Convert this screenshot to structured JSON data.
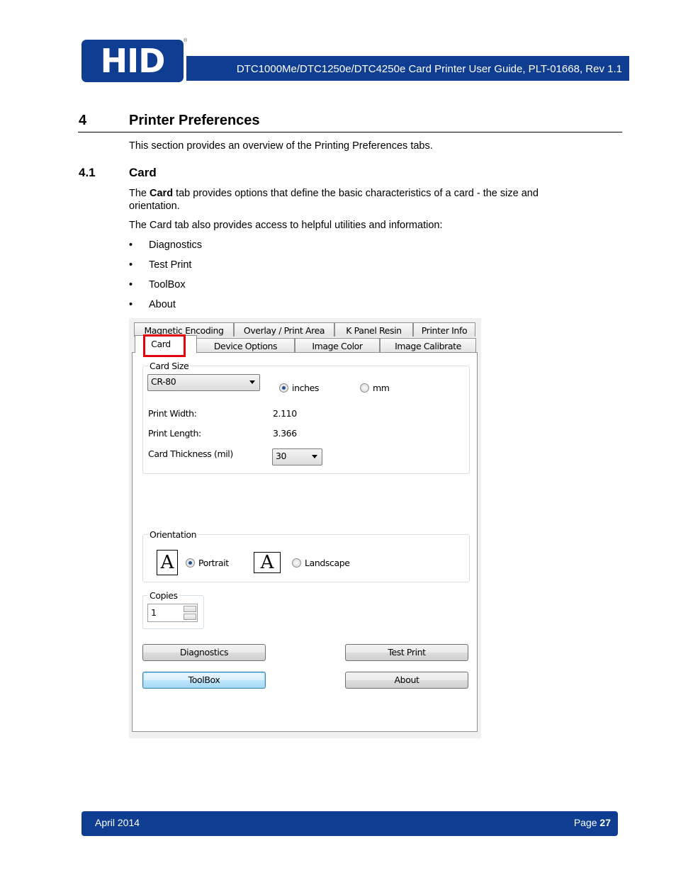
{
  "header": {
    "logo_text": "HID",
    "logo_mark": "®",
    "title": "DTC1000Me/DTC1250e/DTC4250e Card Printer User Guide, PLT-01668, Rev 1.1"
  },
  "section": {
    "number": "4",
    "title": "Printer Preferences",
    "intro": "This section provides an overview of the Printing Preferences tabs."
  },
  "subsection": {
    "number": "4.1",
    "title": "Card",
    "para1_pre": "The ",
    "para1_bold": "Card",
    "para1_post": " tab provides options that define the basic characteristics of a card - the size and orientation.",
    "para2": "The Card tab also provides access to helpful utilities and information:",
    "bullets": [
      "Diagnostics",
      "Test Print",
      "ToolBox",
      "About"
    ]
  },
  "dialog": {
    "tabs_back": [
      "Magnetic Encoding",
      "Overlay / Print Area",
      "K Panel Resin",
      "Printer Info"
    ],
    "tabs_front": [
      "Card",
      "Device Options",
      "Image Color",
      "Image Calibrate"
    ],
    "active_tab": "Card",
    "card_size": {
      "group_label": "Card Size",
      "selected": "CR-80",
      "unit_inches": "inches",
      "unit_mm": "mm",
      "selected_unit": "inches",
      "print_width_label": "Print Width:",
      "print_width_value": "2.110",
      "print_length_label": "Print Length:",
      "print_length_value": "3.366",
      "thickness_label": "Card Thickness (mil)",
      "thickness_value": "30"
    },
    "orientation": {
      "group_label": "Orientation",
      "icon_letter": "A",
      "portrait": "Portrait",
      "landscape": "Landscape",
      "selected": "Portrait"
    },
    "copies": {
      "group_label": "Copies",
      "value": "1"
    },
    "buttons": {
      "diagnostics": "Diagnostics",
      "test_print": "Test Print",
      "toolbox": "ToolBox",
      "about": "About"
    }
  },
  "footer": {
    "date": "April 2014",
    "page_label": "Page ",
    "page_number": "27"
  },
  "colors": {
    "brand_blue": "#0e3d91",
    "highlight_red": "#e3000f"
  }
}
